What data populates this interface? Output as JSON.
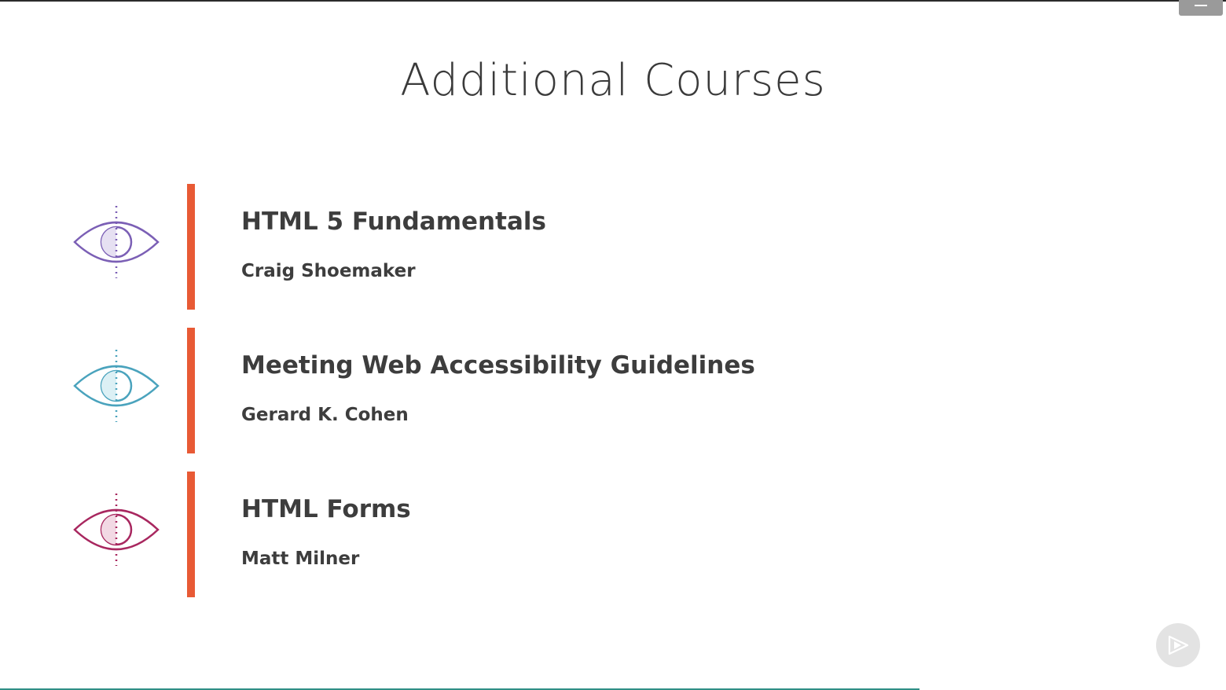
{
  "slide": {
    "title": "Additional Courses"
  },
  "courses": [
    {
      "title": "HTML 5 Fundamentals",
      "author": "Craig Shoemaker",
      "icon": "eye-icon",
      "icon_color": "#7b5fb5",
      "icon_fill": "#e6e0f2"
    },
    {
      "title": "Meeting Web Accessibility Guidelines",
      "author": "Gerard K. Cohen",
      "icon": "eye-icon",
      "icon_color": "#4aa3bd",
      "icon_fill": "#dcf0f5"
    },
    {
      "title": "HTML Forms",
      "author": "Matt Milner",
      "icon": "eye-icon",
      "icon_color": "#a8275f",
      "icon_fill": "#f2d9e4"
    }
  ],
  "colors": {
    "accent_bar": "#e85a35",
    "progress": "#2f8f86"
  },
  "player": {
    "progress_fraction": 0.75,
    "menu_icon": "menu-icon",
    "play_icon": "play-icon"
  }
}
